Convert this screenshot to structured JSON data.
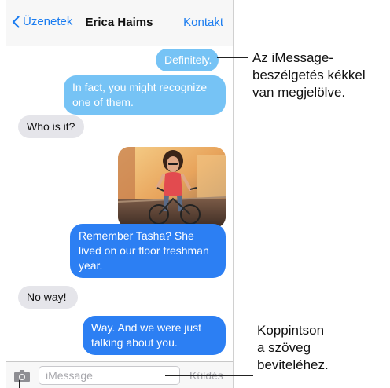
{
  "header": {
    "back_label": "Üzenetek",
    "title": "Erica Haims",
    "contact_label": "Kontakt"
  },
  "messages": [
    {
      "id": "m1",
      "type": "outgoing-imessage",
      "text": "Definitely."
    },
    {
      "id": "m2",
      "type": "outgoing-imessage",
      "text": "In fact, you might recognize one of them."
    },
    {
      "id": "m3",
      "type": "incoming",
      "text": "Who is it?"
    },
    {
      "id": "m4",
      "type": "outgoing-photo",
      "text": ""
    },
    {
      "id": "m5",
      "type": "outgoing-imessage",
      "text": "Remember Tasha? She lived on our floor freshman year."
    },
    {
      "id": "m6",
      "type": "incoming",
      "text": "No way!"
    },
    {
      "id": "m7",
      "type": "outgoing-imessage",
      "text": "Way. And we were just talking about you."
    }
  ],
  "input": {
    "placeholder": "iMessage",
    "send_label": "Küldés",
    "camera_icon": "camera-icon"
  },
  "callouts": {
    "imessage": [
      "Az iMessage-",
      "beszélgetés kékkel",
      "van megjelölve."
    ],
    "input": [
      "Koppintson",
      "a szöveg",
      "beviteléhez."
    ]
  },
  "colors": {
    "accent": "#1a7cf0",
    "imessage_light": "#76c3f5",
    "imessage_dark": "#2c7ff3",
    "incoming": "#e5e5ea"
  }
}
